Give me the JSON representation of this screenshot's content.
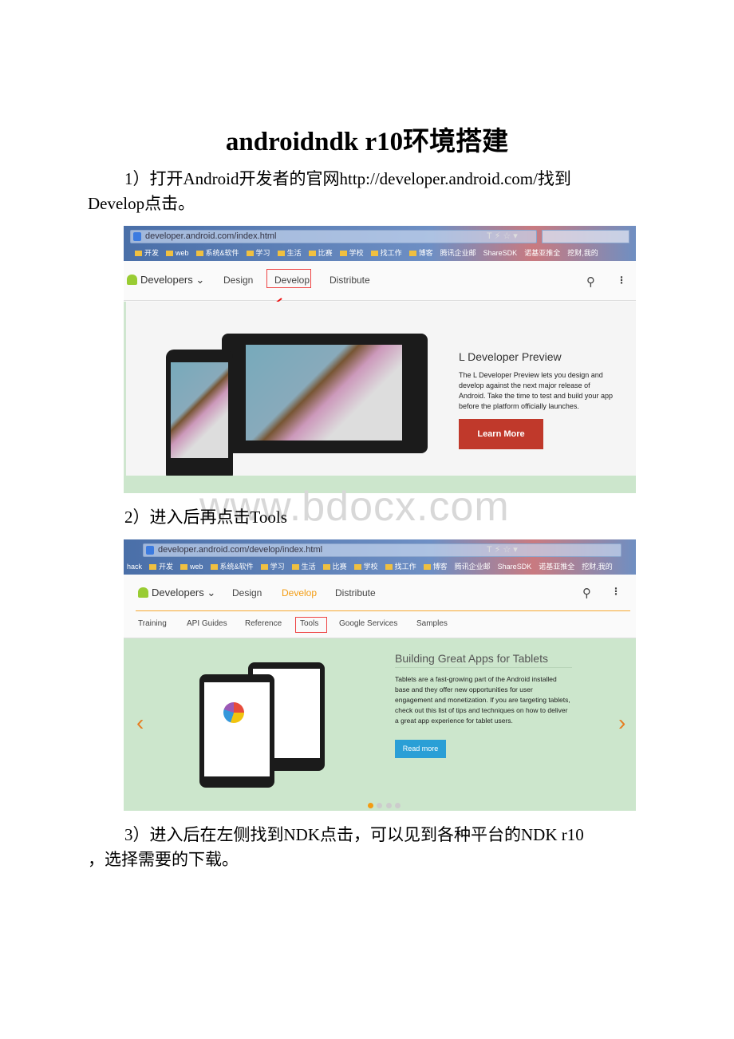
{
  "document": {
    "title": "androidndk r10环境搭建",
    "step1_line1": "1）打开Android开发者的官网http://developer.android.com/找到",
    "step1_line2": "Develop点击。",
    "step2": "2）进入后再点击Tools",
    "step3_line1": "3）进入后在左侧找到NDK点击，可以见到各种平台的NDK r10",
    "step3_line2": "，选择需要的下载。",
    "watermark": "www.bdocx.com"
  },
  "bookmarks": [
    "开发",
    "web",
    "系统&软件",
    "学习",
    "生活",
    "比赛",
    "学校",
    "找工作",
    "博客",
    "腾讯企业邮",
    "ShareSDK",
    "诺基亚推全",
    "挖财,我的"
  ],
  "screenshot1": {
    "url": "developer.android.com/index.html",
    "nav": {
      "logo": "Developers",
      "items": [
        "Design",
        "Develop",
        "Distribute"
      ],
      "highlighted": "Develop"
    },
    "hero": {
      "title": "L Developer Preview",
      "text": "The L Developer Preview lets you design and develop against the next major release of Android. Take the time to test and build your app before the platform officially launches.",
      "button": "Learn More",
      "button_color": "#c0392b"
    }
  },
  "screenshot2": {
    "url": "developer.android.com/develop/index.html",
    "bookmark_prefix": "hack",
    "nav": {
      "logo": "Developers",
      "items": [
        "Design",
        "Develop",
        "Distribute"
      ],
      "active": "Develop",
      "active_color": "#f39c12"
    },
    "subnav": [
      "Training",
      "API Guides",
      "Reference",
      "Tools",
      "Google Services",
      "Samples"
    ],
    "highlighted": "Tools",
    "hero": {
      "title": "Building Great Apps for Tablets",
      "text": "Tablets are a fast-growing part of the Android installed base and they offer new opportunities for user engagement and monetization. If you are targeting tablets, check out this list of tips and techniques on how to deliver a great app experience for tablet users.",
      "button": "Read more",
      "button_color": "#2a9fd6",
      "background": "#cce6cc",
      "slides_total": 4,
      "slide_active": 1
    }
  }
}
